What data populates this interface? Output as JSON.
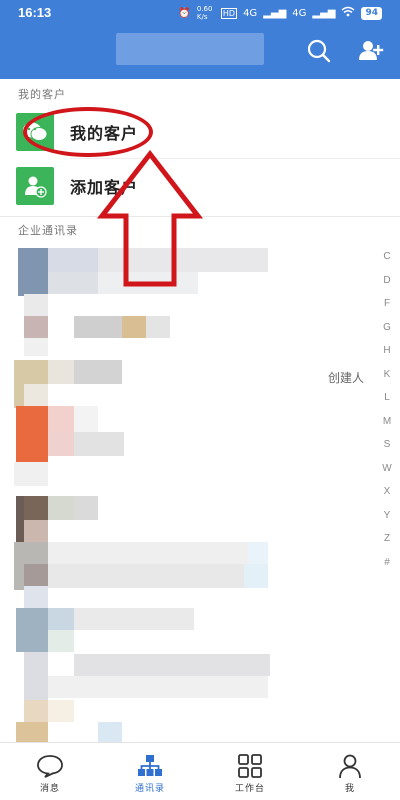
{
  "status_bar": {
    "time": "16:13",
    "net_speed": "0.60 K/s",
    "network_1": "4G",
    "network_2": "4G",
    "battery": "94"
  },
  "header": {
    "search_icon": "search-icon",
    "add_user_icon": "add-user-icon"
  },
  "sections": {
    "my_customers_label": "我的客户",
    "enterprise_directory_label": "企业通讯录"
  },
  "rows": {
    "my_customers": "我的客户",
    "add_customer": "添加客户"
  },
  "contacts": {
    "creator_tag": "创建人"
  },
  "alphabet_index": [
    "C",
    "D",
    "F",
    "G",
    "H",
    "K",
    "L",
    "M",
    "S",
    "W",
    "X",
    "Y",
    "Z",
    "#"
  ],
  "bottom_nav": [
    {
      "label": "消息",
      "icon": "message-icon",
      "active": false
    },
    {
      "label": "通讯录",
      "icon": "contacts-icon",
      "active": true
    },
    {
      "label": "工作台",
      "icon": "workbench-icon",
      "active": false
    },
    {
      "label": "我",
      "icon": "me-icon",
      "active": false
    }
  ],
  "colors": {
    "header_bg": "#3f7fd8",
    "accent_green": "#3cb55a",
    "active_nav": "#2f6fd0",
    "annotation_red": "#d0161b"
  }
}
